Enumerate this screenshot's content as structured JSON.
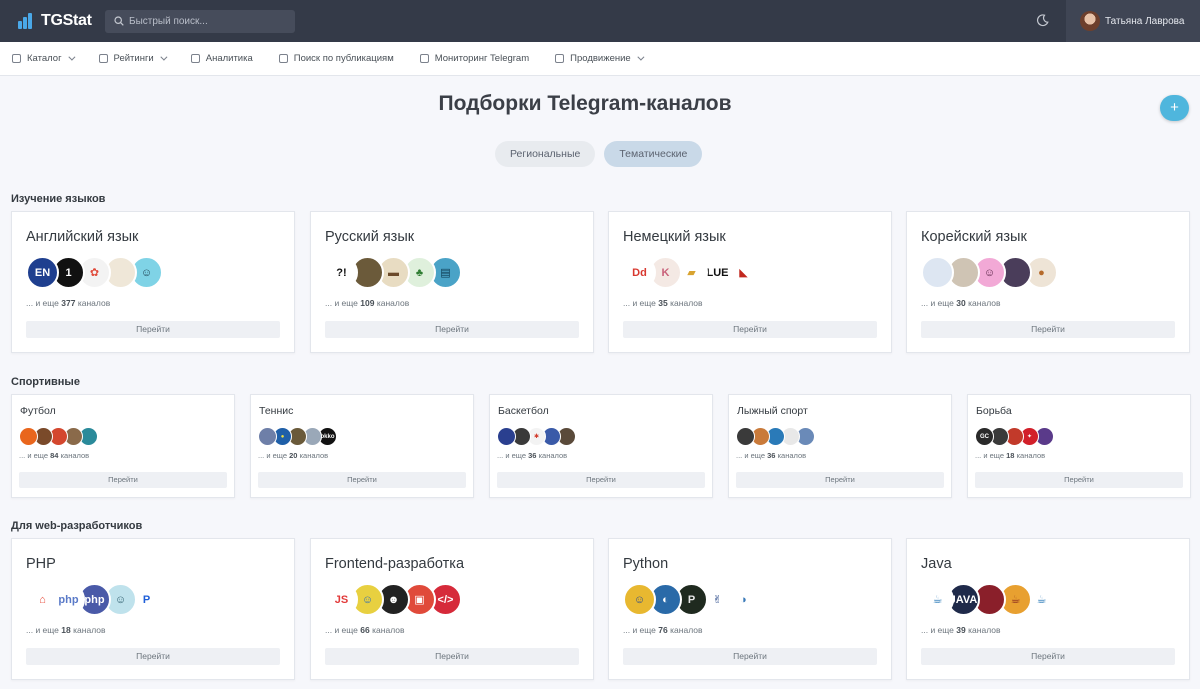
{
  "header": {
    "app_name": "TGStat",
    "search_placeholder": "Быстрый поиск...",
    "user_name": "Татьяна Лаврова"
  },
  "nav": [
    {
      "label": "Каталог",
      "icon": "grid-icon",
      "has_dropdown": true
    },
    {
      "label": "Рейтинги",
      "icon": "list-icon",
      "has_dropdown": true
    },
    {
      "label": "Аналитика",
      "icon": "chart-icon",
      "has_dropdown": false
    },
    {
      "label": "Поиск по публикациям",
      "icon": "search-icon",
      "has_dropdown": false
    },
    {
      "label": "Мониторинг Telegram",
      "icon": "monitor-icon",
      "has_dropdown": false
    },
    {
      "label": "Продвижение",
      "icon": "rocket-icon",
      "has_dropdown": true
    }
  ],
  "page": {
    "title": "Подборки Telegram-каналов",
    "add_label": "+",
    "tabs": [
      {
        "label": "Региональные",
        "active": false
      },
      {
        "label": "Тематические",
        "active": true
      }
    ]
  },
  "more_prefix": "... и еще",
  "more_suffix": "каналов",
  "go_label": "Перейти",
  "sections": [
    {
      "title": "Изучение языков",
      "cards": [
        {
          "title": "Английский язык",
          "count": "377",
          "avatars": [
            {
              "bg": "#1f3f8f",
              "text": "EN",
              "fg": "#ffffff"
            },
            {
              "bg": "#111111",
              "text": "1",
              "fg": "#ffffff"
            },
            {
              "bg": "#f3f3f3",
              "text": "✿",
              "fg": "#e04a3a"
            },
            {
              "bg": "#efe7d8",
              "text": "",
              "fg": "#555"
            },
            {
              "bg": "#7fd3e6",
              "text": "☺",
              "fg": "#1a3a4a"
            }
          ]
        },
        {
          "title": "Русский язык",
          "count": "109",
          "avatars": [
            {
              "bg": "#ffffff",
              "text": "?!",
              "fg": "#111111"
            },
            {
              "bg": "#6b5a3a",
              "text": "",
              "fg": "#fff"
            },
            {
              "bg": "#e8dcc2",
              "text": "▬",
              "fg": "#6b4a2a"
            },
            {
              "bg": "#dff0dc",
              "text": "♣",
              "fg": "#2f7d32"
            },
            {
              "bg": "#4aa3c7",
              "text": "▤",
              "fg": "#0e3b52"
            }
          ]
        },
        {
          "title": "Немецкий язык",
          "count": "35",
          "avatars": [
            {
              "bg": "#ffffff",
              "text": "Dd",
              "fg": "#d8382f"
            },
            {
              "bg": "#f4e9e4",
              "text": "K",
              "fg": "#c9627a"
            },
            {
              "bg": "#ffffff",
              "text": "▰",
              "fg": "#d8a32f"
            },
            {
              "bg": "#ffffff",
              "text": "LUE",
              "fg": "#111111"
            },
            {
              "bg": "#ffffff",
              "text": "◣",
              "fg": "#c2281e"
            }
          ]
        },
        {
          "title": "Корейский язык",
          "count": "30",
          "avatars": [
            {
              "bg": "#dde6f2",
              "text": "",
              "fg": "#333"
            },
            {
              "bg": "#cfc4b4",
              "text": "",
              "fg": "#333"
            },
            {
              "bg": "#f2a9d6",
              "text": "☺",
              "fg": "#552244"
            },
            {
              "bg": "#4a3d5a",
              "text": "",
              "fg": "#fff"
            },
            {
              "bg": "#eee4d6",
              "text": "●",
              "fg": "#b56a2a"
            }
          ]
        }
      ]
    },
    {
      "title": "Спортивные",
      "cards": [
        {
          "title": "Футбол",
          "count": "84",
          "avatars": [
            {
              "bg": "#e9661d",
              "text": "",
              "fg": "#fff"
            },
            {
              "bg": "#7a4a2a",
              "text": "",
              "fg": "#fff"
            },
            {
              "bg": "#d4472e",
              "text": "",
              "fg": "#fff"
            },
            {
              "bg": "#8a6a4a",
              "text": "",
              "fg": "#fff"
            },
            {
              "bg": "#2a8a9a",
              "text": "",
              "fg": "#fff"
            }
          ]
        },
        {
          "title": "Теннис",
          "count": "20",
          "avatars": [
            {
              "bg": "#6e7fa8",
              "text": "",
              "fg": "#fff"
            },
            {
              "bg": "#1f5fa8",
              "text": "●",
              "fg": "#f0e040"
            },
            {
              "bg": "#6a5a3a",
              "text": "",
              "fg": "#fff"
            },
            {
              "bg": "#9aa8b8",
              "text": "",
              "fg": "#fff"
            },
            {
              "bg": "#111111",
              "text": "okko",
              "fg": "#ffffff"
            }
          ]
        },
        {
          "title": "Баскетбол",
          "count": "36",
          "avatars": [
            {
              "bg": "#2a3f8f",
              "text": "",
              "fg": "#fff"
            },
            {
              "bg": "#3a3a3a",
              "text": "",
              "fg": "#fff"
            },
            {
              "bg": "#f3f3f3",
              "text": "✱",
              "fg": "#d23a2a"
            },
            {
              "bg": "#3a5aa8",
              "text": "",
              "fg": "#fff"
            },
            {
              "bg": "#5a4a3a",
              "text": "",
              "fg": "#fff"
            }
          ]
        },
        {
          "title": "Лыжный спорт",
          "count": "36",
          "avatars": [
            {
              "bg": "#3a3a3a",
              "text": "",
              "fg": "#fff"
            },
            {
              "bg": "#c97a3a",
              "text": "",
              "fg": "#fff"
            },
            {
              "bg": "#2a7ab8",
              "text": "",
              "fg": "#fff"
            },
            {
              "bg": "#e8e8e8",
              "text": "",
              "fg": "#333"
            },
            {
              "bg": "#6a8ab8",
              "text": "",
              "fg": "#fff"
            }
          ]
        },
        {
          "title": "Борьба",
          "count": "18",
          "avatars": [
            {
              "bg": "#2a2a2a",
              "text": "GC",
              "fg": "#ffffff"
            },
            {
              "bg": "#3a3a3a",
              "text": "",
              "fg": "#fff"
            },
            {
              "bg": "#c23a2a",
              "text": "",
              "fg": "#fff"
            },
            {
              "bg": "#d21f2a",
              "text": "✦",
              "fg": "#fff"
            },
            {
              "bg": "#5a3a8a",
              "text": "",
              "fg": "#f0d040"
            }
          ]
        }
      ]
    },
    {
      "title": "Для web-разработчиков",
      "cards": [
        {
          "title": "PHP",
          "count": "18",
          "avatars": [
            {
              "bg": "#ffffff",
              "text": "⌂",
              "fg": "#e74a3a"
            },
            {
              "bg": "#ffffff",
              "text": "php",
              "fg": "#5a7ac8"
            },
            {
              "bg": "#4a5aa8",
              "text": "php",
              "fg": "#ffffff"
            },
            {
              "bg": "#bfe2ec",
              "text": "☺",
              "fg": "#2a5a6a"
            },
            {
              "bg": "#ffffff",
              "text": "P",
              "fg": "#1f5fd8"
            }
          ]
        },
        {
          "title": "Frontend-разработка",
          "count": "66",
          "avatars": [
            {
              "bg": "#ffffff",
              "text": "JS",
              "fg": "#e23a3a"
            },
            {
              "bg": "#e8d040",
              "text": "☺",
              "fg": "#2a6ab8"
            },
            {
              "bg": "#222222",
              "text": "☻",
              "fg": "#ffffff"
            },
            {
              "bg": "#e04a3a",
              "text": "▣",
              "fg": "#ffffff"
            },
            {
              "bg": "#d62a3a",
              "text": "</>",
              "fg": "#ffffff"
            }
          ]
        },
        {
          "title": "Python",
          "count": "76",
          "avatars": [
            {
              "bg": "#e8b830",
              "text": "☺",
              "fg": "#2a4a8a"
            },
            {
              "bg": "#2a6aa8",
              "text": "◐",
              "fg": "#ffffff"
            },
            {
              "bg": "#1f2a1f",
              "text": "P",
              "fg": "#e8e8e8"
            },
            {
              "bg": "#ffffff",
              "text": "✌",
              "fg": "#2a4a8a"
            },
            {
              "bg": "#ffffff",
              "text": "◑",
              "fg": "#3a7ab8"
            }
          ]
        },
        {
          "title": "Java",
          "count": "39",
          "avatars": [
            {
              "bg": "#ffffff",
              "text": "☕",
              "fg": "#2a7ab8"
            },
            {
              "bg": "#1f2a4a",
              "text": "JAVA",
              "fg": "#ffffff"
            },
            {
              "bg": "#8a1f2a",
              "text": "",
              "fg": "#fff"
            },
            {
              "bg": "#e8a030",
              "text": "☕",
              "fg": "#8a2a1f"
            },
            {
              "bg": "#ffffff",
              "text": "☕",
              "fg": "#2a7ab8"
            }
          ]
        }
      ]
    }
  ]
}
